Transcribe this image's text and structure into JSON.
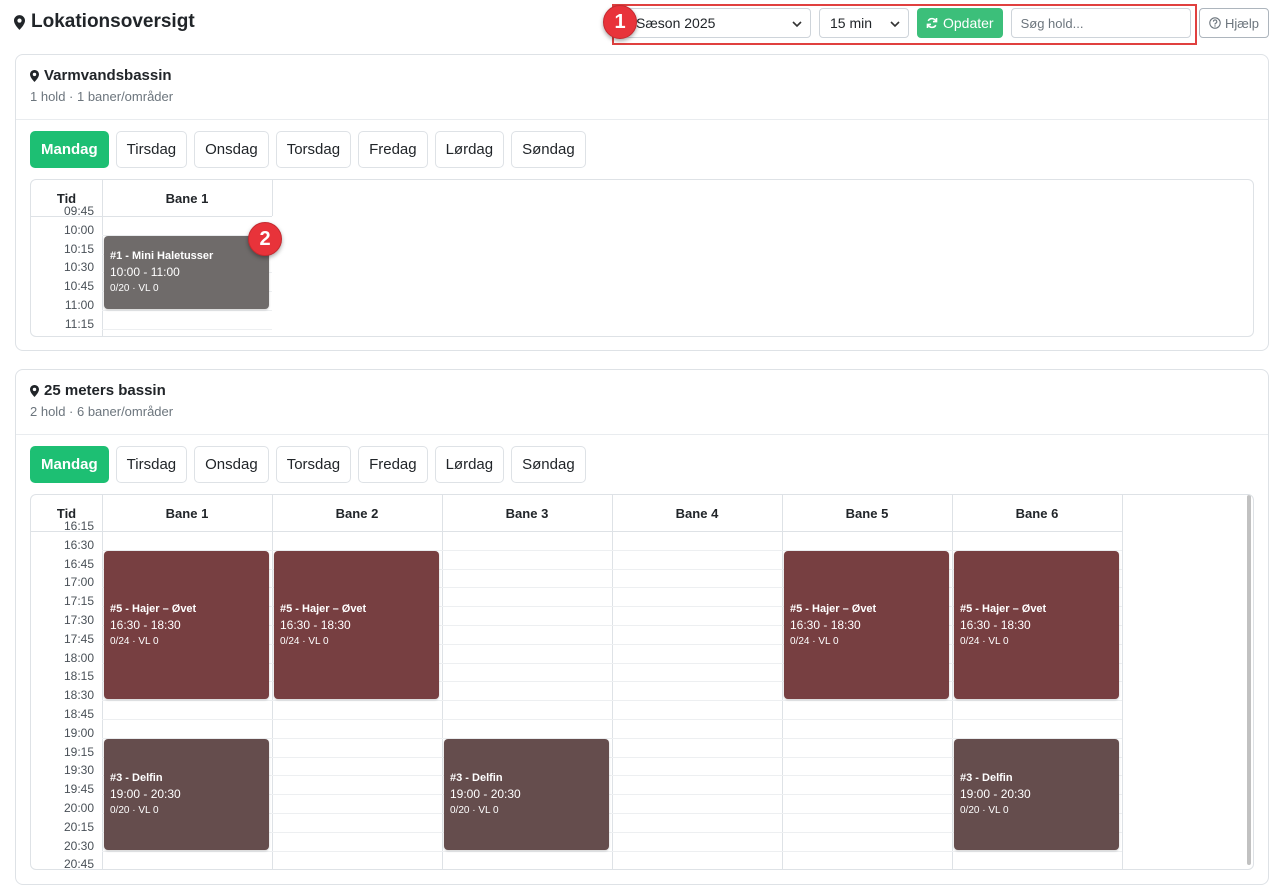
{
  "page_title": "Lokationsoversigt",
  "toolbar": {
    "season_select": "Sæson 2025",
    "interval_select": "15 min",
    "update_label": "Opdater",
    "search_placeholder": "Søg hold...",
    "help_label": "Hjælp"
  },
  "markers": [
    "1",
    "2"
  ],
  "colors": {
    "accent": "#1dbf73",
    "update_button": "#3cbf7a",
    "highlight": "#e0403f",
    "event_gray": "#6f6b6a",
    "event_maroon": "#773f41",
    "event_brown": "#654d4d"
  },
  "days": [
    "Mandag",
    "Tirsdag",
    "Onsdag",
    "Torsdag",
    "Fredag",
    "Lørdag",
    "Søndag"
  ],
  "locations": [
    {
      "name": "Varmvandsbassin",
      "subtitle": "1 hold · 1 baner/områder",
      "time_header": "Tid",
      "lanes": [
        "Bane 1"
      ],
      "ticks": [
        "09:45",
        "10:00",
        "10:15",
        "10:30",
        "10:45",
        "11:00",
        "11:15"
      ],
      "events": [
        {
          "lane": 0,
          "title": "#1 - Mini Haletusser",
          "time": "10:00 - 11:00",
          "meta": "0/20 · VL 0",
          "start": "10:00",
          "end": "11:00",
          "color": "gray"
        }
      ]
    },
    {
      "name": "25 meters bassin",
      "subtitle": "2 hold · 6 baner/områder",
      "time_header": "Tid",
      "lanes": [
        "Bane 1",
        "Bane 2",
        "Bane 3",
        "Bane 4",
        "Bane 5",
        "Bane 6"
      ],
      "ticks": [
        "16:15",
        "16:30",
        "16:45",
        "17:00",
        "17:15",
        "17:30",
        "17:45",
        "18:00",
        "18:15",
        "18:30",
        "18:45",
        "19:00",
        "19:15",
        "19:30",
        "19:45",
        "20:00",
        "20:15",
        "20:30",
        "20:45"
      ],
      "events": [
        {
          "lane": 0,
          "title": "#5 - Hajer – Øvet",
          "time": "16:30 - 18:30",
          "meta": "0/24 · VL 0",
          "start": "16:30",
          "end": "18:30",
          "color": "maroon"
        },
        {
          "lane": 1,
          "title": "#5 - Hajer – Øvet",
          "time": "16:30 - 18:30",
          "meta": "0/24 · VL 0",
          "start": "16:30",
          "end": "18:30",
          "color": "maroon"
        },
        {
          "lane": 4,
          "title": "#5 - Hajer – Øvet",
          "time": "16:30 - 18:30",
          "meta": "0/24 · VL 0",
          "start": "16:30",
          "end": "18:30",
          "color": "maroon"
        },
        {
          "lane": 5,
          "title": "#5 - Hajer – Øvet",
          "time": "16:30 - 18:30",
          "meta": "0/24 · VL 0",
          "start": "16:30",
          "end": "18:30",
          "color": "maroon"
        },
        {
          "lane": 0,
          "title": "#3 - Delfin",
          "time": "19:00 - 20:30",
          "meta": "0/20 · VL 0",
          "start": "19:00",
          "end": "20:30",
          "color": "brown"
        },
        {
          "lane": 2,
          "title": "#3 - Delfin",
          "time": "19:00 - 20:30",
          "meta": "0/20 · VL 0",
          "start": "19:00",
          "end": "20:30",
          "color": "brown"
        },
        {
          "lane": 5,
          "title": "#3 - Delfin",
          "time": "19:00 - 20:30",
          "meta": "0/20 · VL 0",
          "start": "19:00",
          "end": "20:30",
          "color": "brown"
        }
      ]
    }
  ]
}
